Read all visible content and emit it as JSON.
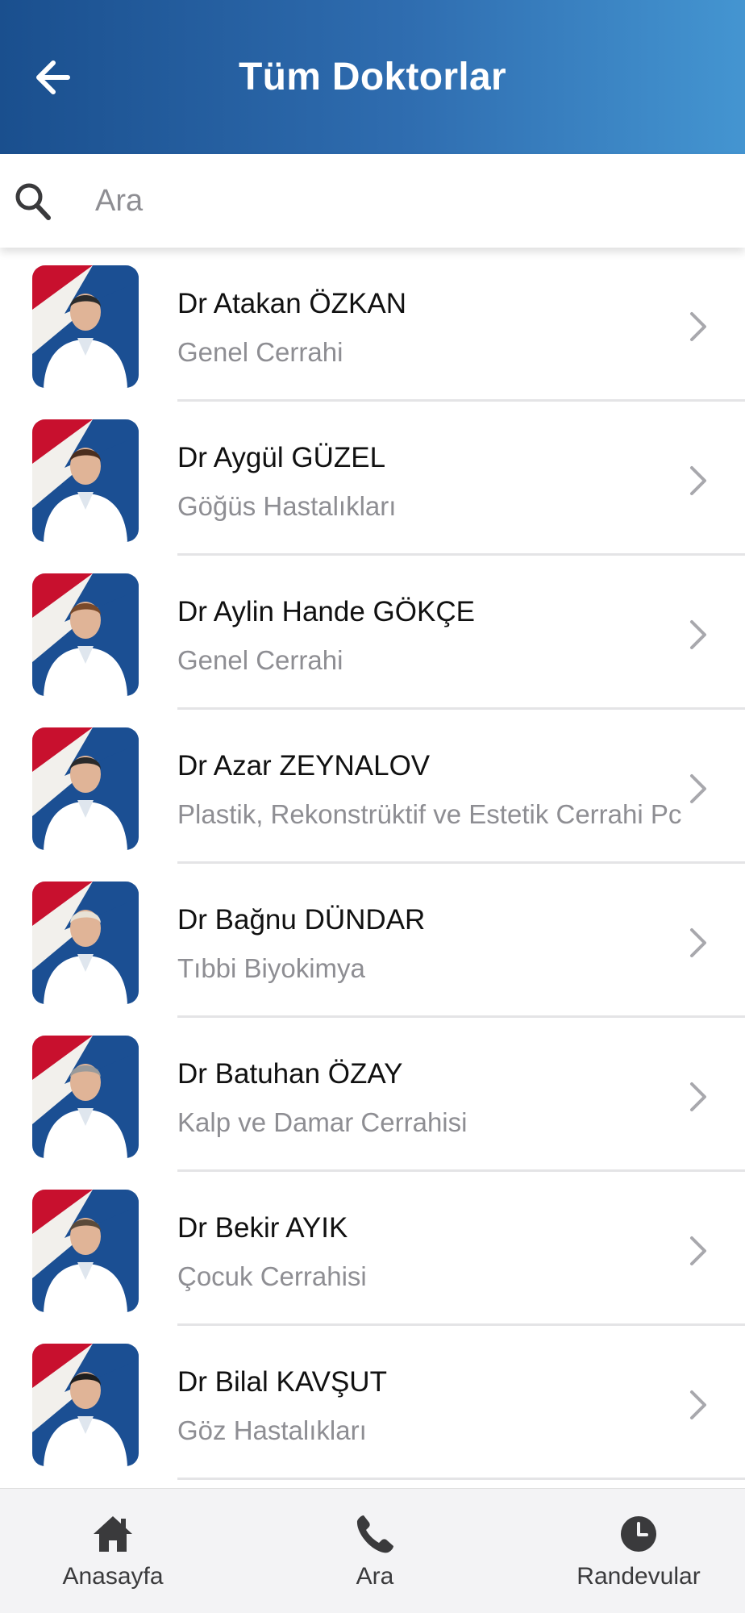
{
  "header": {
    "title": "Tüm Doktorlar",
    "back_icon": "arrow-left-icon"
  },
  "search": {
    "placeholder": "Ara",
    "value": "",
    "icon": "search-icon"
  },
  "doctors": [
    {
      "name": "Dr Atakan ÖZKAN",
      "specialty": "Genel Cerrahi",
      "hair": "#2b2b2b"
    },
    {
      "name": "Dr Aygül GÜZEL",
      "specialty": "Göğüs Hastalıkları",
      "hair": "#4a2e1f"
    },
    {
      "name": "Dr Aylin Hande GÖKÇE",
      "specialty": "Genel Cerrahi",
      "hair": "#7a4a2a"
    },
    {
      "name": "Dr Azar ZEYNALOV",
      "specialty": "Plastik, Rekonstrüktif ve Estetik Cerrahi Pc",
      "hair": "#2a2a2a"
    },
    {
      "name": "Dr Bağnu DÜNDAR",
      "specialty": "Tıbbi Biyokimya",
      "hair": "#e8e2d6"
    },
    {
      "name": "Dr Batuhan ÖZAY",
      "specialty": "Kalp ve Damar Cerrahisi",
      "hair": "#9a9a9a"
    },
    {
      "name": "Dr Bekir AYIK",
      "specialty": "Çocuk Cerrahisi",
      "hair": "#5a4a3a"
    },
    {
      "name": "Dr Bilal KAVŞUT",
      "specialty": "Göz Hastalıkları",
      "hair": "#1e1e1e"
    }
  ],
  "tabs": [
    {
      "label": "Anasayfa",
      "icon": "home-icon"
    },
    {
      "label": "Ara",
      "icon": "phone-icon"
    },
    {
      "label": "Randevular",
      "icon": "clock-icon"
    }
  ],
  "colors": {
    "header_start": "#1a4f8e",
    "header_end": "#4495d1",
    "avatar_blue": "#1b4f93",
    "avatar_red": "#c8102e"
  }
}
